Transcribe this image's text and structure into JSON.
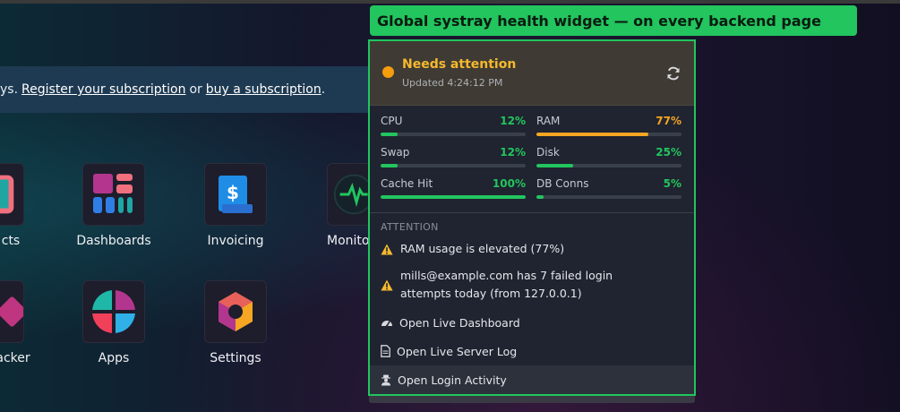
{
  "callout": "Global systray health widget — on every backend page",
  "banner": {
    "prefix": "ys.",
    "register_link": "Register your subscription",
    "or_text": "or",
    "buy_link": "buy a subscription",
    "suffix": "."
  },
  "apps": [
    {
      "label": "cts"
    },
    {
      "label": "Dashboards"
    },
    {
      "label": "Invoicing"
    },
    {
      "label": "Monito"
    },
    {
      "label": "acker"
    },
    {
      "label": "Apps"
    },
    {
      "label": "Settings"
    }
  ],
  "widget": {
    "status": "Needs attention",
    "status_color": "#f59e0b",
    "updated": "Updated 4:24:12 PM",
    "metrics": [
      {
        "name": "CPU",
        "value": "12%",
        "level": 0.12
      },
      {
        "name": "RAM",
        "value": "77%",
        "level": 0.77
      },
      {
        "name": "Swap",
        "value": "12%",
        "level": 0.12
      },
      {
        "name": "Disk",
        "value": "25%",
        "level": 0.25
      },
      {
        "name": "Cache Hit",
        "value": "100%",
        "level": 1.0
      },
      {
        "name": "DB Conns",
        "value": "5%",
        "level": 0.05
      }
    ],
    "attention_heading": "ATTENTION",
    "alerts": [
      {
        "text": "RAM usage is elevated (77%)"
      },
      {
        "text": "mills@example.com has 7 failed login attempts today (from 127.0.0.1)"
      }
    ],
    "links": [
      {
        "label": "Open Live Dashboard"
      },
      {
        "label": "Open Live Server Log"
      },
      {
        "label": "Open Login Activity"
      }
    ]
  }
}
